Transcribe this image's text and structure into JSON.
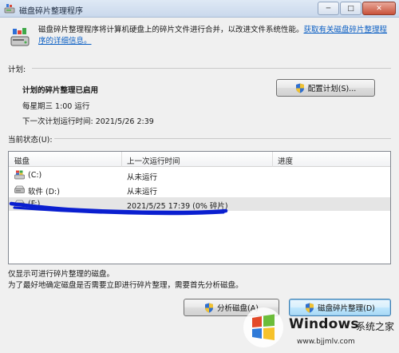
{
  "window": {
    "title": "磁盘碎片整理程序",
    "minimize_glyph": "─",
    "maximize_glyph": "□",
    "close_glyph": "✕"
  },
  "description": {
    "text": "磁盘碎片整理程序将计算机硬盘上的碎片文件进行合并，以改进文件系统性能。",
    "link": "获取有关磁盘碎片整理程序的详细信息。"
  },
  "schedule": {
    "group_label": "计划:",
    "status": "计划的碎片整理已启用",
    "frequency": "每星期三 1:00 运行",
    "next_run": "下一次计划运行时间: 2021/5/26 2:39",
    "configure_button": "配置计划(S)..."
  },
  "current_status": {
    "group_label": "当前状态(U):",
    "columns": [
      "磁盘",
      "上一次运行时间",
      "进度"
    ],
    "rows": [
      {
        "disk": "(C:)",
        "last_run": "从未运行",
        "progress": "",
        "icon": "system-drive-icon"
      },
      {
        "disk": "软件 (D:)",
        "last_run": "从未运行",
        "progress": "",
        "icon": "hard-drive-icon"
      },
      {
        "disk": "(F:)",
        "last_run": "2021/5/25 17:39 (0% 碎片)",
        "progress": "",
        "icon": "hard-drive-icon"
      }
    ],
    "selected_row": 2
  },
  "footer": {
    "note1": "仅显示可进行碎片整理的磁盘。",
    "note2": "为了最好地确定磁盘是否需要立即进行碎片整理，需要首先分析磁盘。",
    "analyze_button": "分析磁盘(A)",
    "defrag_button": "磁盘碎片整理(D)"
  },
  "watermark": {
    "brand": "Windows",
    "cn": "系统之家",
    "url": "www.bjjmlv.com"
  },
  "colors": {
    "link": "#0b5fc4",
    "scribble": "#0a1fd0",
    "selected_row": "#e5e5e5"
  }
}
